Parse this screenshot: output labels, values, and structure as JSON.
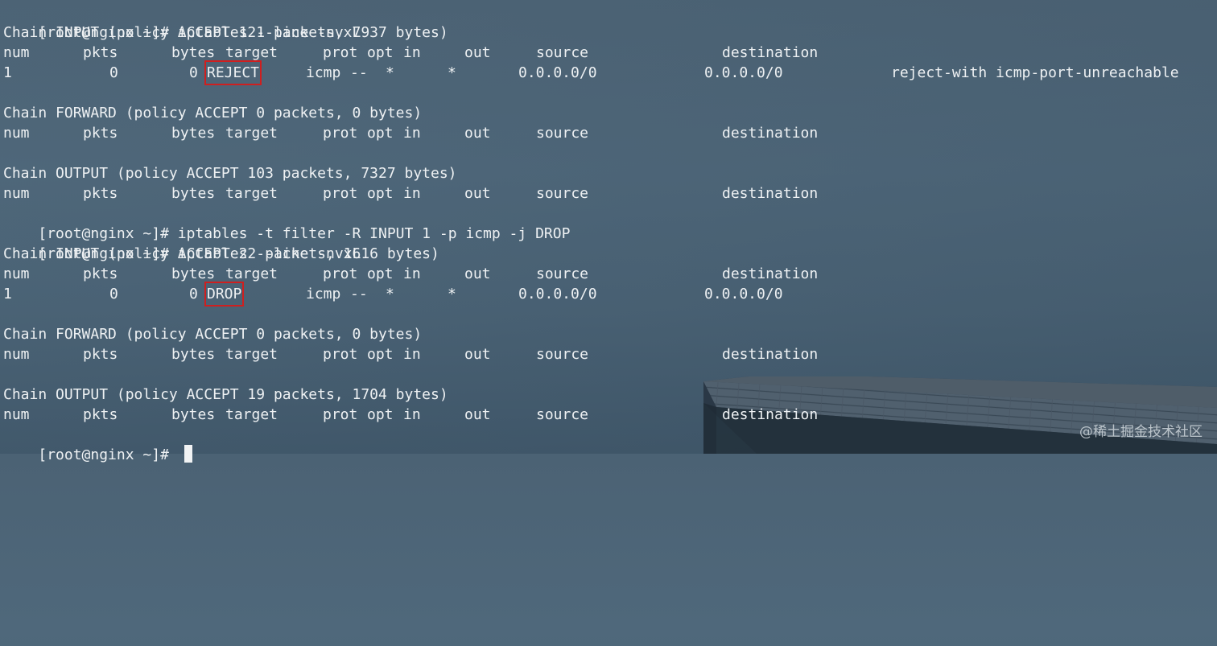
{
  "terminal": {
    "prompt": "[root@nginx ~]# ",
    "commands": [
      "iptables --line -nvxL",
      "iptables -t filter -R INPUT 1 -p icmp -j DROP",
      "iptables --line -nvxL"
    ],
    "chains": {
      "input_1": "Chain INPUT (policy ACCEPT 121 packets, 7937 bytes)",
      "forward_1": "Chain FORWARD (policy ACCEPT 0 packets, 0 bytes)",
      "output_1": "Chain OUTPUT (policy ACCEPT 103 packets, 7327 bytes)",
      "input_2": "Chain INPUT (policy ACCEPT 22 packets, 1616 bytes)",
      "forward_2": "Chain FORWARD (policy ACCEPT 0 packets, 0 bytes)",
      "output_2": "Chain OUTPUT (policy ACCEPT 19 packets, 1704 bytes)"
    },
    "header": {
      "num": "num",
      "pkts": "pkts",
      "bytes": "bytes",
      "target": "target",
      "prot": "prot",
      "opt": "opt",
      "in": "in",
      "out": "out",
      "source": "source",
      "destination": "destination"
    },
    "rules": [
      {
        "num": "1",
        "pkts": "0",
        "bytes": "0",
        "target": "REJECT",
        "prot": "icmp",
        "opt": "--",
        "in": "*",
        "out": "*",
        "source": "0.0.0.0/0",
        "destination": "0.0.0.0/0",
        "extra": "reject-with icmp-port-unreachable"
      },
      {
        "num": "1",
        "pkts": "0",
        "bytes": "0",
        "target": "DROP",
        "prot": "icmp",
        "opt": "--",
        "in": "*",
        "out": "*",
        "source": "0.0.0.0/0",
        "destination": "0.0.0.0/0"
      }
    ]
  },
  "watermark": "@稀土掘金技术社区",
  "colors": {
    "text": "#eef1f3",
    "highlight_box": "#cf1f1f",
    "background": "#4f687b"
  }
}
